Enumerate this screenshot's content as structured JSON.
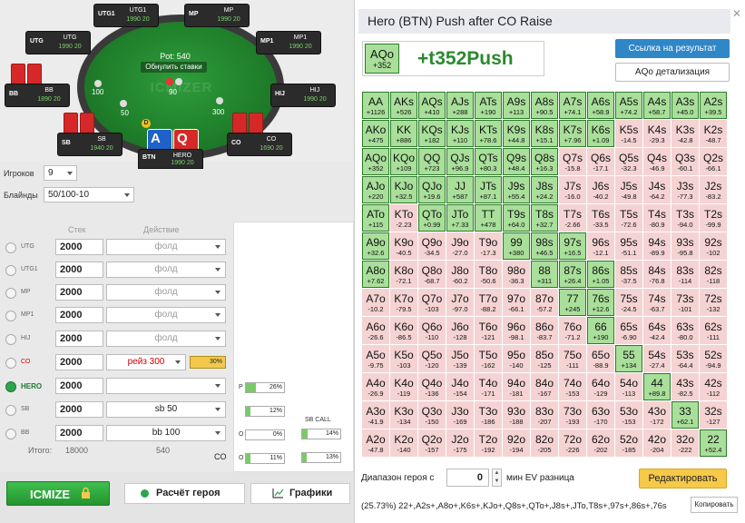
{
  "table": {
    "pot_label": "Pot: 540",
    "reset_label": "Обнулить ставки",
    "watermark": "ICMIZER",
    "dealer": "D",
    "bets": {
      "utg": "100",
      "sb": "50",
      "bb": "300",
      "hero_center": "90"
    },
    "players": [
      {
        "pos": "UTG1",
        "name": "UTG1",
        "stack": "1990 20"
      },
      {
        "pos": "MP",
        "name": "MP",
        "stack": "1990 20"
      },
      {
        "pos": "UTG",
        "name": "UTG",
        "stack": "1990 20"
      },
      {
        "pos": "MP1",
        "name": "MP1",
        "stack": "1990 20"
      },
      {
        "pos": "BB",
        "name": "BB",
        "stack": "1890 20"
      },
      {
        "pos": "HIJ",
        "name": "HIJ",
        "stack": "1990 20"
      },
      {
        "pos": "SB",
        "name": "SB",
        "stack": "1940 20"
      },
      {
        "pos": "CO",
        "name": "CO",
        "stack": "1690 20"
      },
      {
        "pos": "BTN",
        "name": "HERO",
        "stack": "1990 20"
      }
    ],
    "hero_cards": [
      "A",
      "Q"
    ]
  },
  "controls": {
    "players_label": "Игроков",
    "players_value": "9",
    "blinds_label": "Блайнды",
    "blinds_value": "50/100-10",
    "stack_head": "Стек",
    "action_head": "Действие"
  },
  "positions": [
    {
      "label": "UTG",
      "stack": "2000",
      "action": "фолд"
    },
    {
      "label": "UTG1",
      "stack": "2000",
      "action": "фолд"
    },
    {
      "label": "MP",
      "stack": "2000",
      "action": "фолд"
    },
    {
      "label": "MP1",
      "stack": "2000",
      "action": "фолд"
    },
    {
      "label": "HIJ",
      "stack": "2000",
      "action": "фолд"
    },
    {
      "label": "CO",
      "stack": "2000",
      "action": "рейз 300",
      "badge": "30%"
    },
    {
      "label": "HERO",
      "stack": "2000",
      "action": ""
    },
    {
      "label": "SB",
      "stack": "2000",
      "action": "sb 50"
    },
    {
      "label": "BB",
      "stack": "2000",
      "action": "bb 100"
    }
  ],
  "totals": {
    "label": "Итого:",
    "stack": "18000",
    "pot": "540",
    "pos": "CO"
  },
  "mini": {
    "p_label": "P",
    "p_val": "26%",
    "sb_val": "12%",
    "bb_val": "0%",
    "call_title": "SB CALL",
    "call_val": "14%",
    "call_val2": "13%",
    "o_lbl": "O",
    "m_val": "11%"
  },
  "buttons": {
    "icmize": "ICMIZE",
    "calc": "Расчёт героя",
    "graphs": "Графики"
  },
  "result": {
    "title": "Hero (BTN) Push after CO Raise",
    "hand": "AQo",
    "hand_ev": "+352",
    "push_text": "+t352Push",
    "link_btn": "Ссылка на результат",
    "detail_btn": "AQo детализация",
    "range_label": "Диапазон героя с",
    "range_value": "0",
    "range_label2": "мин EV разница",
    "edit_btn": "Редактировать",
    "range_text": "(25.73%) 22+,A2s+,A8o+,K6s+,KJo+,Q8s+,QTo+,J8s+,JTo,T8s+,97s+,86s+,76s",
    "copy_btn": "Копировать"
  },
  "matrix": [
    [
      [
        "AA",
        "+1126",
        1
      ],
      [
        "AKs",
        "+526",
        1
      ],
      [
        "AQs",
        "+410",
        1
      ],
      [
        "AJs",
        "+288",
        1
      ],
      [
        "ATs",
        "+190",
        1
      ],
      [
        "A9s",
        "+113",
        1
      ],
      [
        "A8s",
        "+90.5",
        1
      ],
      [
        "A7s",
        "+74.1",
        1
      ],
      [
        "A6s",
        "+58.9",
        1
      ],
      [
        "A5s",
        "+74.2",
        1
      ],
      [
        "A4s",
        "+58.7",
        1
      ],
      [
        "A3s",
        "+45.0",
        1
      ],
      [
        "A2s",
        "+39.5",
        1
      ]
    ],
    [
      [
        "AKo",
        "+475",
        1
      ],
      [
        "KK",
        "+886",
        1
      ],
      [
        "KQs",
        "+182",
        1
      ],
      [
        "KJs",
        "+110",
        1
      ],
      [
        "KTs",
        "+78.6",
        1
      ],
      [
        "K9s",
        "+44.8",
        1
      ],
      [
        "K8s",
        "+15.1",
        1
      ],
      [
        "K7s",
        "+7.96",
        1
      ],
      [
        "K6s",
        "+1.09",
        1
      ],
      [
        "K5s",
        "-14.5",
        0
      ],
      [
        "K4s",
        "-29.3",
        0
      ],
      [
        "K3s",
        "-42.8",
        0
      ],
      [
        "K2s",
        "-48.7",
        0
      ]
    ],
    [
      [
        "AQo",
        "+352",
        1
      ],
      [
        "KQo",
        "+109",
        1
      ],
      [
        "QQ",
        "+723",
        1
      ],
      [
        "QJs",
        "+96.9",
        1
      ],
      [
        "QTs",
        "+80.3",
        1
      ],
      [
        "Q9s",
        "+48.4",
        1
      ],
      [
        "Q8s",
        "+16.3",
        1
      ],
      [
        "Q7s",
        "-15.8",
        0
      ],
      [
        "Q6s",
        "-17.1",
        0
      ],
      [
        "Q5s",
        "-32.3",
        0
      ],
      [
        "Q4s",
        "-46.9",
        0
      ],
      [
        "Q3s",
        "-60.1",
        0
      ],
      [
        "Q2s",
        "-66.1",
        0
      ]
    ],
    [
      [
        "AJo",
        "+220",
        1
      ],
      [
        "KJo",
        "+32.5",
        1
      ],
      [
        "QJo",
        "+19.6",
        1
      ],
      [
        "JJ",
        "+587",
        1
      ],
      [
        "JTs",
        "+87.1",
        1
      ],
      [
        "J9s",
        "+55.4",
        1
      ],
      [
        "J8s",
        "+24.2",
        1
      ],
      [
        "J7s",
        "-16.0",
        0
      ],
      [
        "J6s",
        "-40.2",
        0
      ],
      [
        "J5s",
        "-49.8",
        0
      ],
      [
        "J4s",
        "-64.2",
        0
      ],
      [
        "J3s",
        "-77.3",
        0
      ],
      [
        "J2s",
        "-83.2",
        0
      ]
    ],
    [
      [
        "ATo",
        "+115",
        1
      ],
      [
        "KTo",
        "-2.23",
        0
      ],
      [
        "QTo",
        "+0.99",
        1
      ],
      [
        "JTo",
        "+7.33",
        1
      ],
      [
        "TT",
        "+478",
        1
      ],
      [
        "T9s",
        "+64.0",
        1
      ],
      [
        "T8s",
        "+32.7",
        1
      ],
      [
        "T7s",
        "-2.66",
        0
      ],
      [
        "T6s",
        "-33.5",
        0
      ],
      [
        "T5s",
        "-72.6",
        0
      ],
      [
        "T4s",
        "-80.9",
        0
      ],
      [
        "T3s",
        "-94.0",
        0
      ],
      [
        "T2s",
        "-99.9",
        0
      ]
    ],
    [
      [
        "A9o",
        "+32.6",
        1
      ],
      [
        "K9o",
        "-40.5",
        0
      ],
      [
        "Q9o",
        "-34.5",
        0
      ],
      [
        "J9o",
        "-27.0",
        0
      ],
      [
        "T9o",
        "-17.3",
        0
      ],
      [
        "99",
        "+380",
        1
      ],
      [
        "98s",
        "+46.5",
        1
      ],
      [
        "97s",
        "+16.5",
        1
      ],
      [
        "96s",
        "-12.1",
        0
      ],
      [
        "95s",
        "-51.1",
        0
      ],
      [
        "94s",
        "-89.9",
        0
      ],
      [
        "93s",
        "-95.8",
        0
      ],
      [
        "92s",
        "-102",
        0
      ]
    ],
    [
      [
        "A8o",
        "+7.62",
        1
      ],
      [
        "K8o",
        "-72.1",
        0
      ],
      [
        "Q8o",
        "-68.7",
        0
      ],
      [
        "J8o",
        "-60.2",
        0
      ],
      [
        "T8o",
        "-50.6",
        0
      ],
      [
        "98o",
        "-36.3",
        0
      ],
      [
        "88",
        "+311",
        1
      ],
      [
        "87s",
        "+26.4",
        1
      ],
      [
        "86s",
        "+1.05",
        1
      ],
      [
        "85s",
        "-37.5",
        0
      ],
      [
        "84s",
        "-76.8",
        0
      ],
      [
        "83s",
        "-114",
        0
      ],
      [
        "82s",
        "-118",
        0
      ]
    ],
    [
      [
        "A7o",
        "-10.2",
        0
      ],
      [
        "K7o",
        "-79.5",
        0
      ],
      [
        "Q7o",
        "-103",
        0
      ],
      [
        "J7o",
        "-97.0",
        0
      ],
      [
        "T7o",
        "-88.2",
        0
      ],
      [
        "97o",
        "-66.1",
        0
      ],
      [
        "87o",
        "-57.2",
        0
      ],
      [
        "77",
        "+245",
        1
      ],
      [
        "76s",
        "+12.6",
        1
      ],
      [
        "75s",
        "-24.5",
        0
      ],
      [
        "74s",
        "-63.7",
        0
      ],
      [
        "73s",
        "-101",
        0
      ],
      [
        "72s",
        "-132",
        0
      ]
    ],
    [
      [
        "A6o",
        "-26.6",
        0
      ],
      [
        "K6o",
        "-86.5",
        0
      ],
      [
        "Q6o",
        "-110",
        0
      ],
      [
        "J6o",
        "-128",
        0
      ],
      [
        "T6o",
        "-121",
        0
      ],
      [
        "96o",
        "-98.1",
        0
      ],
      [
        "86o",
        "-83.7",
        0
      ],
      [
        "76o",
        "-71.2",
        0
      ],
      [
        "66",
        "+190",
        1
      ],
      [
        "65s",
        "-6.90",
        0
      ],
      [
        "64s",
        "-42.4",
        0
      ],
      [
        "63s",
        "-80.0",
        0
      ],
      [
        "62s",
        "-111",
        0
      ]
    ],
    [
      [
        "A5o",
        "-9.75",
        0
      ],
      [
        "K5o",
        "-103",
        0
      ],
      [
        "Q5o",
        "-120",
        0
      ],
      [
        "J5o",
        "-139",
        0
      ],
      [
        "T5o",
        "-162",
        0
      ],
      [
        "95o",
        "-140",
        0
      ],
      [
        "85o",
        "-125",
        0
      ],
      [
        "75o",
        "-111",
        0
      ],
      [
        "65o",
        "-88.9",
        0
      ],
      [
        "55",
        "+134",
        1
      ],
      [
        "54s",
        "-27.4",
        0
      ],
      [
        "53s",
        "-64.4",
        0
      ],
      [
        "52s",
        "-94.9",
        0
      ]
    ],
    [
      [
        "A4o",
        "-26.9",
        0
      ],
      [
        "K4o",
        "-119",
        0
      ],
      [
        "Q4o",
        "-136",
        0
      ],
      [
        "J4o",
        "-154",
        0
      ],
      [
        "T4o",
        "-171",
        0
      ],
      [
        "94o",
        "-181",
        0
      ],
      [
        "84o",
        "-167",
        0
      ],
      [
        "74o",
        "-153",
        0
      ],
      [
        "64o",
        "-129",
        0
      ],
      [
        "54o",
        "-113",
        0
      ],
      [
        "44",
        "+89.8",
        1
      ],
      [
        "43s",
        "-82.5",
        0
      ],
      [
        "42s",
        "-112",
        0
      ]
    ],
    [
      [
        "A3o",
        "-41.9",
        0
      ],
      [
        "K3o",
        "-134",
        0
      ],
      [
        "Q3o",
        "-150",
        0
      ],
      [
        "J3o",
        "-169",
        0
      ],
      [
        "T3o",
        "-186",
        0
      ],
      [
        "93o",
        "-188",
        0
      ],
      [
        "83o",
        "-207",
        0
      ],
      [
        "73o",
        "-193",
        0
      ],
      [
        "63o",
        "-170",
        0
      ],
      [
        "53o",
        "-153",
        0
      ],
      [
        "43o",
        "-172",
        0
      ],
      [
        "33",
        "+62.1",
        1
      ],
      [
        "32s",
        "-127",
        0
      ]
    ],
    [
      [
        "A2o",
        "-47.8",
        0
      ],
      [
        "K2o",
        "-140",
        0
      ],
      [
        "Q2o",
        "-157",
        0
      ],
      [
        "J2o",
        "-175",
        0
      ],
      [
        "T2o",
        "-192",
        0
      ],
      [
        "92o",
        "-194",
        0
      ],
      [
        "82o",
        "-205",
        0
      ],
      [
        "72o",
        "-226",
        0
      ],
      [
        "62o",
        "-202",
        0
      ],
      [
        "52o",
        "-185",
        0
      ],
      [
        "42o",
        "-204",
        0
      ],
      [
        "32o",
        "-222",
        0
      ],
      [
        "22",
        "+52.4",
        1
      ]
    ]
  ]
}
